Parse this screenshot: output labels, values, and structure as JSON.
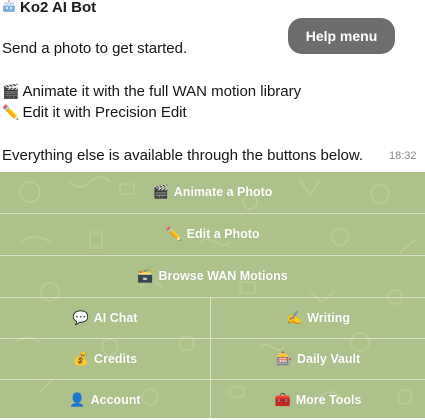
{
  "bot": {
    "avatar_icon": "robot-cake-icon",
    "name": "Ko2 AI Bot"
  },
  "help_button": {
    "label": "Help menu"
  },
  "message": {
    "intro": "Send a photo to get started.",
    "animate_icon": "🎬",
    "animate_keyword": "Animate",
    "animate_rest": " it with the full WAN motion library",
    "edit_icon": "✏️",
    "edit_keyword": "Edit",
    "edit_rest": " it with Precision Edit",
    "outro": "Everything else is available through the buttons below.",
    "time": "18:32"
  },
  "keyboard": {
    "animate": {
      "icon": "🎬",
      "label": "Animate a Photo"
    },
    "edit": {
      "icon": "✏️",
      "label": "Edit a Photo"
    },
    "browse": {
      "icon": "🗃️",
      "label": "Browse WAN Motions"
    },
    "ai_chat": {
      "icon": "💬",
      "label": "AI Chat"
    },
    "writing": {
      "icon": "✍️",
      "label": "Writing"
    },
    "credits": {
      "icon": "💰",
      "label": "Credits"
    },
    "vault": {
      "icon": "🎰",
      "label": "Daily Vault"
    },
    "account": {
      "icon": "👤",
      "label": "Account"
    },
    "more": {
      "icon": "🧰",
      "label": "More Tools"
    }
  },
  "colors": {
    "keyboard_bg": "#a6bc80",
    "help_button_bg": "#5e5e5e"
  }
}
